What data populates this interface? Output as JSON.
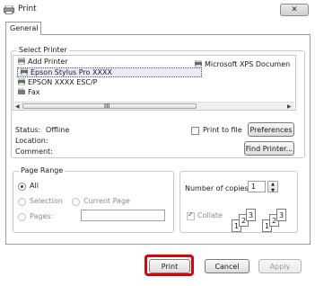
{
  "window": {
    "title": "Print",
    "close_symbol": "✕"
  },
  "tabs": [
    "General"
  ],
  "select_printer": {
    "label": "Select Printer",
    "printers": [
      {
        "name": "Add Printer"
      },
      {
        "name": "Epson Stylus Pro XXXX"
      },
      {
        "name": "EPSON XXXX ESC/P"
      },
      {
        "name": "Fax"
      },
      {
        "name": "Microsoft XPS Documen"
      }
    ],
    "scroll_grip": "III",
    "arrow_left": "◀",
    "arrow_right": "▶"
  },
  "status": {
    "status_label": "Status:",
    "status_value": "Offline",
    "location_label": "Location:",
    "comment_label": "Comment:",
    "print_to_file_label": "Print to file",
    "preferences_label": "Preferences",
    "find_printer_label": "Find Printer..."
  },
  "page_range": {
    "label": "Page Range",
    "all": "All",
    "selection": "Selection",
    "current_page": "Current Page",
    "pages": "Pages:",
    "pages_value": ""
  },
  "copies": {
    "label": "Number of copies:",
    "value": "1",
    "collate_label": "Collate",
    "collate_pages": [
      "1",
      "2",
      "3"
    ]
  },
  "buttons": {
    "print": "Print",
    "cancel": "Cancel",
    "apply": "Apply"
  },
  "colors": {
    "highlight": "#e00000",
    "selection_bg": "#e8eef7"
  }
}
